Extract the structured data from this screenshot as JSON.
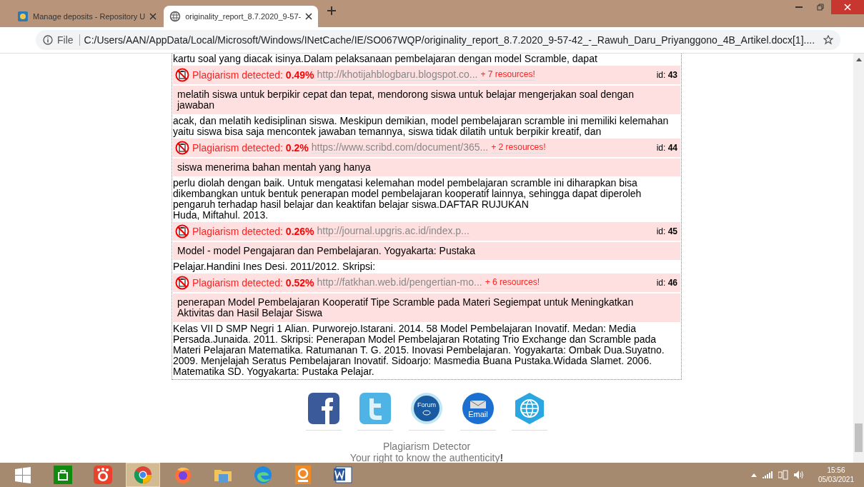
{
  "browser": {
    "tabs": [
      {
        "title": "Manage deposits - Repository U",
        "selected": false
      },
      {
        "title": "originality_report_8.7.2020_9-57-",
        "selected": true
      }
    ],
    "address": {
      "scheme": "File",
      "url": "C:/Users/AAN/AppData/Local/Microsoft/Windows/INetCache/IE/SO067WQP/originality_report_8.7.2020_9-57-42_-_Rawuh_Daru_Priyanggono_4B_Artikel.docx[1]...."
    }
  },
  "report": {
    "blocks": [
      {
        "kind": "text",
        "text": "kartu soal yang diacak isinya.Dalam pelaksanaan pembelajaran dengan model Scramble, dapat"
      },
      {
        "kind": "match",
        "label": "Plagiarism detected:",
        "percent": "0.49%",
        "url": "http://khotijahblogbaru.blogspot.co...",
        "resources": "+ 7 resources!",
        "id": "id: **43**",
        "text": "melatih siswa untuk berpikir cepat dan tepat, mendorong siswa untuk belajar mengerjakan soal dengan jawaban"
      },
      {
        "kind": "text",
        "text": "acak, dan melatih kedisiplinan siswa. Meskipun demikian, model pembelajaran scramble ini memiliki kelemahan yaitu siswa bisa saja mencontek jawaban temannya, siswa tidak dilatih untuk berpikir kreatif, dan"
      },
      {
        "kind": "match",
        "label": "Plagiarism detected:",
        "percent": "0.2%",
        "url": "https://www.scribd.com/document/365...",
        "resources": "+ 2 resources!",
        "id": "id: **44**",
        "text": "siswa menerima bahan mentah yang hanya"
      },
      {
        "kind": "text",
        "text": "perlu diolah dengan baik. Untuk mengatasi kelemahan model pembelajaran scramble ini diharapkan bisa dikembangkan untuk bentuk penerapan model pembelajaran kooperatif lainnya, sehingga dapat diperoleh pengaruh terhadap hasil belajar dan keaktifan belajar siswa.DAFTAR RUJUKAN\nHuda, Miftahul. 2013."
      },
      {
        "kind": "match",
        "label": "Plagiarism detected:",
        "percent": "0.26%",
        "url": "http://journal.upgris.ac.id/index.p...",
        "id": "id: **45**",
        "text": "Model - model Pengajaran dan Pembelajaran. Yogyakarta: Pustaka"
      },
      {
        "kind": "text",
        "text": "Pelajar.Handini Ines Desi. 2011/2012. Skripsi:"
      },
      {
        "kind": "match",
        "label": "Plagiarism detected:",
        "percent": "0.52%",
        "url": "http://fatkhan.web.id/pengertian-mo...",
        "resources": "+ 6 resources!",
        "id": "id: **46**",
        "text": "penerapan Model Pembelajaran Kooperatif Tipe Scramble pada Materi Segiempat untuk Meningkatkan Aktivitas dan Hasil Belajar Siswa"
      },
      {
        "kind": "text",
        "text": "Kelas VII D SMP Negri 1 Alian. Purworejo.Istarani. 2014. 58 Model Pembelajaran Inovatif. Medan: Media Persada.Junaida. 2011. Skripsi: Penerapan Model Pembelajaran Rotating Trio Exchange dan Scramble pada Materi Pelajaran Matematika. Ratumanan T. G. 2015. Inovasi Pembelajaran. Yogyakarta: Ombak Dua.Suyatno. 2009. Menjelajah Seratus Pembelajaran Inovatif. Sidoarjo: Masmedia Buana Pustaka.Widada Slamet. 2006. Matematika SD. Yogyakarta: Pustaka Pelajar."
      }
    ]
  },
  "share": [
    {
      "kind": "facebook"
    },
    {
      "kind": "twitter"
    },
    {
      "kind": "forum",
      "label": "Forum"
    },
    {
      "kind": "email",
      "label": "Email"
    },
    {
      "kind": "web"
    }
  ],
  "footer": {
    "title": "Plagiarism Detector",
    "tagline": "Your right to know the authenticity**!**"
  },
  "taskbar": {
    "apps": [
      {
        "kind": "start",
        "selected": false
      },
      {
        "kind": "store",
        "selected": false
      },
      {
        "kind": "camera",
        "selected": false
      },
      {
        "kind": "chrome",
        "selected": true
      },
      {
        "kind": "firefox",
        "selected": false
      },
      {
        "kind": "folder",
        "selected": false
      },
      {
        "kind": "edge",
        "selected": false
      },
      {
        "kind": "pdf",
        "selected": false
      },
      {
        "kind": "word",
        "selected": false
      }
    ],
    "time": "15:56",
    "date": "05/03/2021"
  }
}
